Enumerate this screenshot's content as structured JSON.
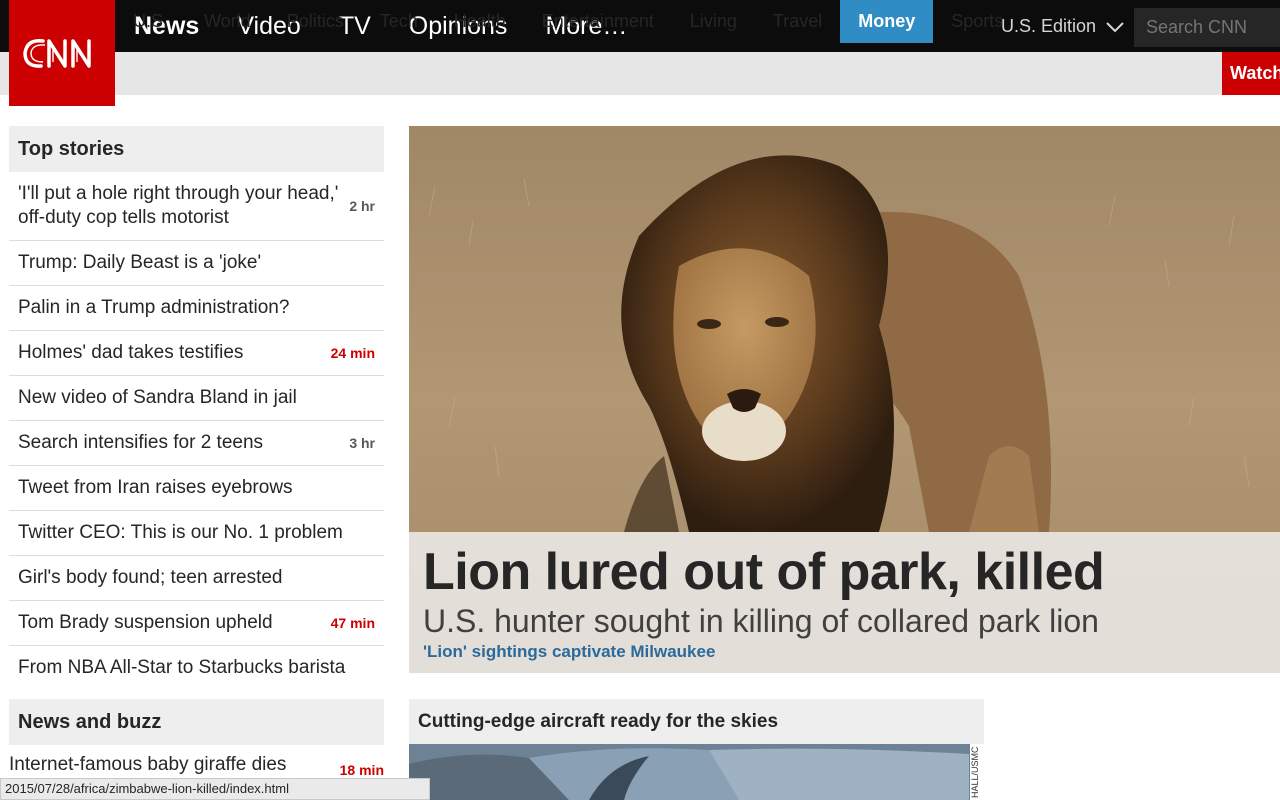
{
  "logo": {
    "text": "CNN"
  },
  "top_nav": [
    {
      "label": "News",
      "strong": true
    },
    {
      "label": "Video"
    },
    {
      "label": "TV"
    },
    {
      "label": "Opinions"
    },
    {
      "label": "More…"
    }
  ],
  "edition": {
    "label": "U.S. Edition"
  },
  "search": {
    "placeholder": "Search CNN"
  },
  "sub_nav": [
    {
      "label": "U.S."
    },
    {
      "label": "World"
    },
    {
      "label": "Politics"
    },
    {
      "label": "Tech"
    },
    {
      "label": "Health"
    },
    {
      "label": "Entertainment"
    },
    {
      "label": "Living"
    },
    {
      "label": "Travel"
    },
    {
      "label": "Money",
      "active": true
    },
    {
      "label": "Sports"
    }
  ],
  "watch": {
    "label": "Watch"
  },
  "top_stories": {
    "heading": "Top stories",
    "items": [
      {
        "title": "'I'll put a hole right through your head,' off-duty cop tells motorist",
        "time": "2 hr",
        "time_color": "gray"
      },
      {
        "title": "Trump: Daily Beast is a 'joke'",
        "time": ""
      },
      {
        "title": "Palin in a Trump administration?",
        "time": ""
      },
      {
        "title": "Holmes' dad takes testifies",
        "time": "24 min",
        "time_color": "red"
      },
      {
        "title": "New video of Sandra Bland in jail",
        "time": ""
      },
      {
        "title": "Search intensifies for 2 teens",
        "time": "3 hr",
        "time_color": "gray"
      },
      {
        "title": "Tweet from Iran raises eyebrows",
        "time": ""
      },
      {
        "title": "Twitter CEO: This is our No. 1 problem",
        "time": ""
      },
      {
        "title": "Girl's body found; teen arrested",
        "time": ""
      },
      {
        "title": "Tom Brady suspension upheld",
        "time": "47 min",
        "time_color": "red"
      },
      {
        "title": "From NBA All-Star to Starbucks barista",
        "time": ""
      }
    ]
  },
  "news_buzz": {
    "heading": "News and buzz",
    "first_item": {
      "title": "Internet-famous baby giraffe dies",
      "time": "18 min"
    }
  },
  "hero": {
    "title": "Lion lured out of park, killed",
    "subtitle": "U.S. hunter sought in killing of collared park lion",
    "link": "'Lion' sightings captivate Milwaukee"
  },
  "card": {
    "heading": "Cutting-edge aircraft ready for the skies",
    "credit": "HALL/USMC"
  },
  "status_bar": {
    "url": "2015/07/28/africa/zimbabwe-lion-killed/index.html"
  },
  "colors": {
    "brand_red": "#cc0000",
    "active_blue": "#2f8cc5",
    "link_blue": "#2b6a9a"
  }
}
